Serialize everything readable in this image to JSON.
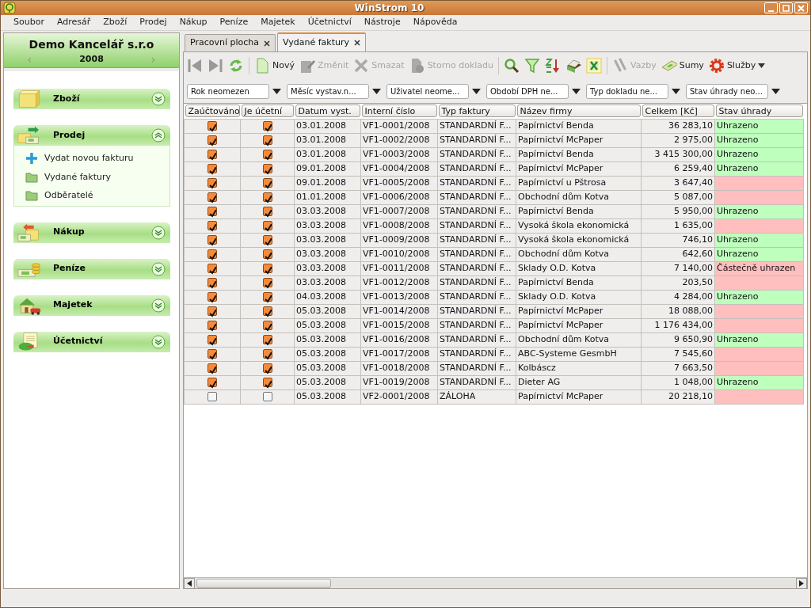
{
  "window": {
    "title": "WinStrom 10"
  },
  "menu": [
    "Soubor",
    "Adresář",
    "Zboží",
    "Prodej",
    "Nákup",
    "Peníze",
    "Majetek",
    "Účetnictví",
    "Nástroje",
    "Nápověda"
  ],
  "company": {
    "name": "Demo Kancelář s.r.o",
    "year": "2008",
    "prev": "‹",
    "next": "›"
  },
  "sidebar": [
    {
      "title": "Zboží",
      "kind": "box",
      "expanded": false
    },
    {
      "title": "Prodej",
      "kind": "sale",
      "expanded": true,
      "items": [
        {
          "label": "Vydat novou fakturu",
          "kind": "add"
        },
        {
          "label": "Vydané faktury",
          "kind": "folder"
        },
        {
          "label": "Odběratelé",
          "kind": "folder"
        }
      ]
    },
    {
      "title": "Nákup",
      "kind": "purchase",
      "expanded": false
    },
    {
      "title": "Peníze",
      "kind": "money",
      "expanded": false
    },
    {
      "title": "Majetek",
      "kind": "house",
      "expanded": false
    },
    {
      "title": "Účetnictví",
      "kind": "ledger",
      "expanded": false
    }
  ],
  "tabs": [
    {
      "label": "Pracovní plocha",
      "selected": false
    },
    {
      "label": "Vydané faktury",
      "selected": true
    }
  ],
  "toolbar": [
    {
      "kind": "first"
    },
    {
      "kind": "last"
    },
    {
      "kind": "refresh"
    },
    {
      "kind": "sep"
    },
    {
      "kind": "new",
      "label": "Nový",
      "disabled": false
    },
    {
      "kind": "edit",
      "label": "Změnit",
      "disabled": true
    },
    {
      "kind": "delete",
      "label": "Smazat",
      "disabled": true
    },
    {
      "kind": "storno",
      "label": "Storno dokladu",
      "disabled": true
    },
    {
      "kind": "sep"
    },
    {
      "kind": "search"
    },
    {
      "kind": "filter"
    },
    {
      "kind": "sort"
    },
    {
      "kind": "print"
    },
    {
      "kind": "excel"
    },
    {
      "kind": "sep"
    },
    {
      "kind": "links",
      "label": "Vazby",
      "disabled": true
    },
    {
      "kind": "sums",
      "label": "Sumy",
      "disabled": false
    },
    {
      "kind": "services",
      "label": "Služby",
      "disabled": false
    }
  ],
  "filters": [
    "Rok neomezen",
    "Měsíc vystav.n...",
    "Uživatel neome...",
    "Období DPH ne...",
    "Typ dokladu ne...",
    "Stav úhrady neo..."
  ],
  "table": {
    "columns": [
      "Zaúčtováno",
      "Je účetní",
      "Datum vyst.",
      "Interní číslo",
      "Typ faktury",
      "Název firmy",
      "Celkem [Kč]",
      "Stav úhrady"
    ],
    "rows": [
      {
        "posted": true,
        "accounting": true,
        "date": "03.01.2008",
        "number": "VF1-0001/2008",
        "type": "STANDARDNÍ F...",
        "firm": "Papírnictví Benda",
        "total": "36 283,10",
        "status": "Uhrazeno",
        "paid": true
      },
      {
        "posted": true,
        "accounting": true,
        "date": "03.01.2008",
        "number": "VF1-0002/2008",
        "type": "STANDARDNÍ F...",
        "firm": "Papírnictví McPaper",
        "total": "2 975,00",
        "status": "Uhrazeno",
        "paid": true
      },
      {
        "posted": true,
        "accounting": true,
        "date": "03.01.2008",
        "number": "VF1-0003/2008",
        "type": "STANDARDNÍ F...",
        "firm": "Papírnictví Benda",
        "total": "3 415 300,00",
        "status": "Uhrazeno",
        "paid": true
      },
      {
        "posted": true,
        "accounting": true,
        "date": "09.01.2008",
        "number": "VF1-0004/2008",
        "type": "STANDARDNÍ F...",
        "firm": "Papírnictví McPaper",
        "total": "6 259,40",
        "status": "Uhrazeno",
        "paid": true
      },
      {
        "posted": true,
        "accounting": true,
        "date": "09.01.2008",
        "number": "VF1-0005/2008",
        "type": "STANDARDNÍ F...",
        "firm": "Papírnictví u Pštrosa",
        "total": "3 647,40",
        "paid": false
      },
      {
        "posted": true,
        "accounting": true,
        "date": "01.01.2008",
        "number": "VF1-0006/2008",
        "type": "STANDARDNÍ F...",
        "firm": "Obchodní dům Kotva",
        "total": "5 087,00",
        "paid": false
      },
      {
        "posted": true,
        "accounting": true,
        "date": "03.03.2008",
        "number": "VF1-0007/2008",
        "type": "STANDARDNÍ F...",
        "firm": "Papírnictví Benda",
        "total": "5 950,00",
        "status": "Uhrazeno",
        "paid": true
      },
      {
        "posted": true,
        "accounting": true,
        "date": "03.03.2008",
        "number": "VF1-0008/2008",
        "type": "STANDARDNÍ F...",
        "firm": "Vysoká škola ekonomická",
        "total": "1 635,00",
        "paid": false
      },
      {
        "posted": true,
        "accounting": true,
        "date": "03.03.2008",
        "number": "VF1-0009/2008",
        "type": "STANDARDNÍ F...",
        "firm": "Vysoká škola ekonomická",
        "total": "746,10",
        "status": "Uhrazeno",
        "paid": true
      },
      {
        "posted": true,
        "accounting": true,
        "date": "03.03.2008",
        "number": "VF1-0010/2008",
        "type": "STANDARDNÍ F...",
        "firm": "Obchodní dům Kotva",
        "total": "642,60",
        "status": "Uhrazeno",
        "paid": true
      },
      {
        "posted": true,
        "accounting": true,
        "date": "03.03.2008",
        "number": "VF1-0011/2008",
        "type": "STANDARDNÍ F...",
        "firm": "Sklady O.D. Kotva",
        "total": "7 140,00",
        "status": "Částečně uhrazen",
        "paid": false
      },
      {
        "posted": true,
        "accounting": true,
        "date": "03.03.2008",
        "number": "VF1-0012/2008",
        "type": "STANDARDNÍ F...",
        "firm": "Papírnictví Benda",
        "total": "203,50",
        "paid": false
      },
      {
        "posted": true,
        "accounting": true,
        "date": "04.03.2008",
        "number": "VF1-0013/2008",
        "type": "STANDARDNÍ F...",
        "firm": "Sklady O.D. Kotva",
        "total": "4 284,00",
        "status": "Uhrazeno",
        "paid": true
      },
      {
        "posted": true,
        "accounting": true,
        "date": "05.03.2008",
        "number": "VF1-0014/2008",
        "type": "STANDARDNÍ F...",
        "firm": "Papírnictví McPaper",
        "total": "18 088,00",
        "paid": false
      },
      {
        "posted": true,
        "accounting": true,
        "date": "05.03.2008",
        "number": "VF1-0015/2008",
        "type": "STANDARDNÍ F...",
        "firm": "Papírnictví McPaper",
        "total": "1 176 434,00",
        "paid": false
      },
      {
        "posted": true,
        "accounting": true,
        "date": "05.03.2008",
        "number": "VF1-0016/2008",
        "type": "STANDARDNÍ F...",
        "firm": "Obchodní dům Kotva",
        "total": "9 650,90",
        "status": "Uhrazeno",
        "paid": true
      },
      {
        "posted": true,
        "accounting": true,
        "date": "05.03.2008",
        "number": "VF1-0017/2008",
        "type": "STANDARDNÍ F...",
        "firm": "ABC-Systeme GesmbH",
        "total": "7 545,60",
        "paid": false
      },
      {
        "posted": true,
        "accounting": true,
        "date": "05.03.2008",
        "number": "VF1-0018/2008",
        "type": "STANDARDNÍ F...",
        "firm": "Kolbáscz",
        "total": "7 663,50",
        "paid": false
      },
      {
        "posted": true,
        "accounting": true,
        "date": "05.03.2008",
        "number": "VF1-0019/2008",
        "type": "STANDARDNÍ F...",
        "firm": "Dieter AG",
        "total": "1 048,00",
        "status": "Uhrazeno",
        "paid": true
      },
      {
        "posted": false,
        "accounting": false,
        "date": "05.03.2008",
        "number": "VF2-0001/2008",
        "type": "ZÁLOHA",
        "firm": "Papírnictví McPaper",
        "total": "20 218,10",
        "paid": false
      }
    ]
  }
}
